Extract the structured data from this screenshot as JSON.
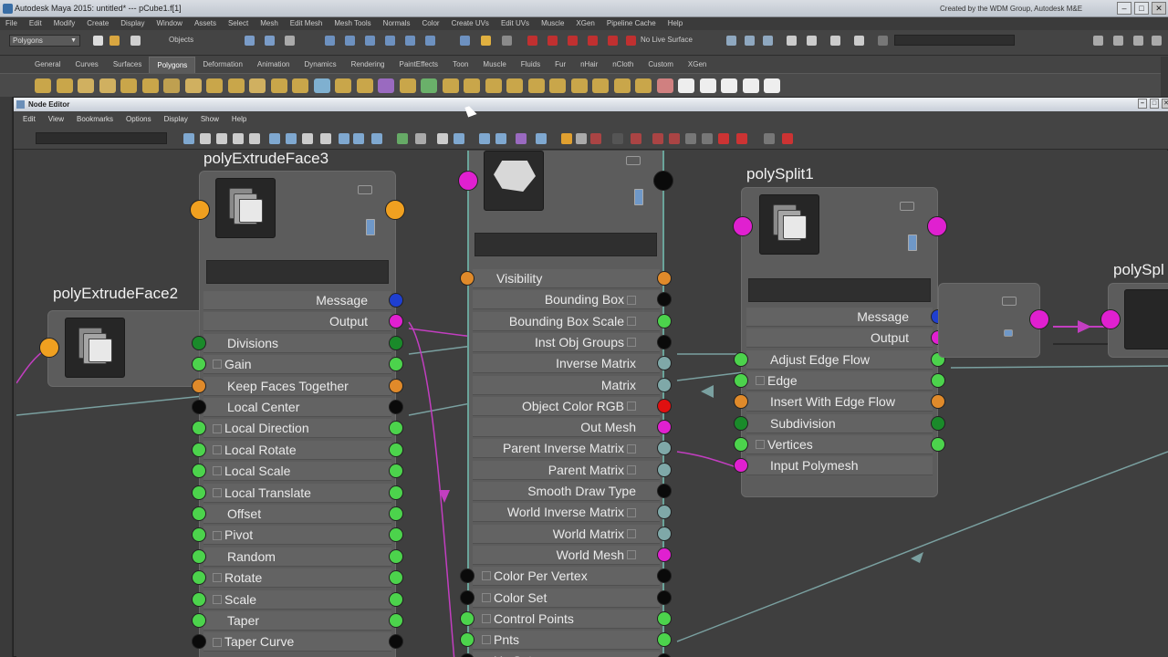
{
  "app": {
    "title": "Autodesk Maya 2015: untitled*   ---   pCube1.f[1]",
    "credit": "Created by the WDM Group, Autodesk M&E",
    "menu": [
      "File",
      "Edit",
      "Modify",
      "Create",
      "Display",
      "Window",
      "Assets",
      "Select",
      "Mesh",
      "Edit Mesh",
      "Mesh Tools",
      "Normals",
      "Color",
      "Create UVs",
      "Edit UVs",
      "Muscle",
      "XGen",
      "Pipeline Cache",
      "Help"
    ]
  },
  "status_line": {
    "mode": "Polygons",
    "objects_label": "Objects",
    "live_label": "No Live Surface"
  },
  "shelf": {
    "tabs": [
      "General",
      "Curves",
      "Surfaces",
      "Polygons",
      "Deformation",
      "Animation",
      "Dynamics",
      "Rendering",
      "PaintEffects",
      "Toon",
      "Muscle",
      "Fluids",
      "Fur",
      "nHair",
      "nCloth",
      "Custom",
      "XGen"
    ],
    "active_tab": "Polygons"
  },
  "node_editor": {
    "title": "Node Editor",
    "menu": [
      "Edit",
      "View",
      "Bookmarks",
      "Options",
      "Display",
      "Show",
      "Help"
    ],
    "nodes": {
      "n3": {
        "title": "polyExtrudeFace3",
        "rows": [
          {
            "label": "Message",
            "align": "right",
            "in": null,
            "out": "#1f3fd0"
          },
          {
            "label": "Output",
            "align": "right",
            "in": null,
            "out": "#e020d0"
          },
          {
            "label": "Divisions",
            "align": "left",
            "in": "#1a8a2a",
            "out": "#1a8a2a"
          },
          {
            "label": "Gain",
            "align": "left",
            "plus": true,
            "in": "#4cd34c",
            "out": "#4cd34c"
          },
          {
            "label": "Keep Faces Together",
            "align": "left",
            "in": "#e08a2a",
            "out": "#e08a2a"
          },
          {
            "label": "Local Center",
            "align": "left",
            "in": "#0a0a0a",
            "out": "#0a0a0a"
          },
          {
            "label": "Local Direction",
            "align": "left",
            "plus": true,
            "in": "#4cd34c",
            "out": "#4cd34c"
          },
          {
            "label": "Local Rotate",
            "align": "left",
            "plus": true,
            "in": "#4cd34c",
            "out": "#4cd34c"
          },
          {
            "label": "Local Scale",
            "align": "left",
            "plus": true,
            "in": "#4cd34c",
            "out": "#4cd34c"
          },
          {
            "label": "Local Translate",
            "align": "left",
            "plus": true,
            "in": "#4cd34c",
            "out": "#4cd34c"
          },
          {
            "label": "Offset",
            "align": "left",
            "in": "#4cd34c",
            "out": "#4cd34c"
          },
          {
            "label": "Pivot",
            "align": "left",
            "plus": true,
            "in": "#4cd34c",
            "out": "#4cd34c"
          },
          {
            "label": "Random",
            "align": "left",
            "in": "#4cd34c",
            "out": "#4cd34c"
          },
          {
            "label": "Rotate",
            "align": "left",
            "plus": true,
            "in": "#4cd34c",
            "out": "#4cd34c"
          },
          {
            "label": "Scale",
            "align": "left",
            "plus": true,
            "in": "#4cd34c",
            "out": "#4cd34c"
          },
          {
            "label": "Taper",
            "align": "left",
            "in": "#4cd34c",
            "out": "#4cd34c"
          },
          {
            "label": "Taper Curve",
            "align": "left",
            "plus": true,
            "in": "#0a0a0a",
            "out": "#0a0a0a"
          }
        ]
      },
      "n2": {
        "title": "polyExtrudeFace2"
      },
      "mid": {
        "rows": [
          {
            "label": "Visibility",
            "align": "left",
            "in": "#e08a2a",
            "out": "#e08a2a"
          },
          {
            "label": "Bounding Box",
            "align": "right",
            "plus": true,
            "in": null,
            "out": "#0a0a0a"
          },
          {
            "label": "Bounding Box Scale",
            "align": "right",
            "plus": true,
            "in": null,
            "out": "#4cd34c"
          },
          {
            "label": "Inst Obj Groups",
            "align": "right",
            "plus": true,
            "in": null,
            "out": "#0a0a0a"
          },
          {
            "label": "Inverse Matrix",
            "align": "right",
            "in": null,
            "out": "#7fa8a8"
          },
          {
            "label": "Matrix",
            "align": "right",
            "in": null,
            "out": "#7fa8a8"
          },
          {
            "label": "Object Color RGB",
            "align": "right",
            "plus": true,
            "in": null,
            "out": "#e01010"
          },
          {
            "label": "Out Mesh",
            "align": "right",
            "in": null,
            "out": "#e020d0"
          },
          {
            "label": "Parent Inverse Matrix",
            "align": "right",
            "plus": true,
            "in": null,
            "out": "#7fa8a8"
          },
          {
            "label": "Parent Matrix",
            "align": "right",
            "plus": true,
            "in": null,
            "out": "#7fa8a8"
          },
          {
            "label": "Smooth Draw Type",
            "align": "right",
            "in": null,
            "out": "#0a0a0a"
          },
          {
            "label": "World Inverse Matrix",
            "align": "right",
            "plus": true,
            "in": null,
            "out": "#7fa8a8"
          },
          {
            "label": "World Matrix",
            "align": "right",
            "plus": true,
            "in": null,
            "out": "#7fa8a8"
          },
          {
            "label": "World Mesh",
            "align": "right",
            "plus": true,
            "in": null,
            "out": "#e020d0"
          },
          {
            "label": "Color Per Vertex",
            "align": "left",
            "plus": true,
            "in": "#0a0a0a",
            "out": "#0a0a0a"
          },
          {
            "label": "Color Set",
            "align": "left",
            "plus": true,
            "in": "#0a0a0a",
            "out": "#0a0a0a"
          },
          {
            "label": "Control Points",
            "align": "left",
            "plus": true,
            "in": "#4cd34c",
            "out": "#4cd34c"
          },
          {
            "label": "Pnts",
            "align": "left",
            "plus": true,
            "in": "#4cd34c",
            "out": "#4cd34c"
          },
          {
            "label": "Uv Set",
            "align": "left",
            "plus": true,
            "in": "#0a0a0a",
            "out": "#0a0a0a"
          }
        ]
      },
      "split1": {
        "title": "polySplit1",
        "rows": [
          {
            "label": "Message",
            "align": "right",
            "in": null,
            "out": "#1f3fd0"
          },
          {
            "label": "Output",
            "align": "right",
            "in": null,
            "out": "#e020d0"
          },
          {
            "label": "Adjust Edge Flow",
            "align": "left",
            "in": "#4cd34c",
            "out": "#4cd34c"
          },
          {
            "label": "Edge",
            "align": "left",
            "plus": true,
            "in": "#4cd34c",
            "out": "#4cd34c"
          },
          {
            "label": "Insert With Edge Flow",
            "align": "left",
            "in": "#e08a2a",
            "out": "#e08a2a"
          },
          {
            "label": "Subdivision",
            "align": "left",
            "in": "#1a8a2a",
            "out": "#1a8a2a"
          },
          {
            "label": "Vertices",
            "align": "left",
            "plus": true,
            "in": "#4cd34c",
            "out": "#4cd34c"
          },
          {
            "label": "Input Polymesh",
            "align": "left",
            "in": "#e020d0",
            "out": null
          }
        ]
      },
      "split_partial": {
        "title": "polySpl"
      }
    }
  }
}
